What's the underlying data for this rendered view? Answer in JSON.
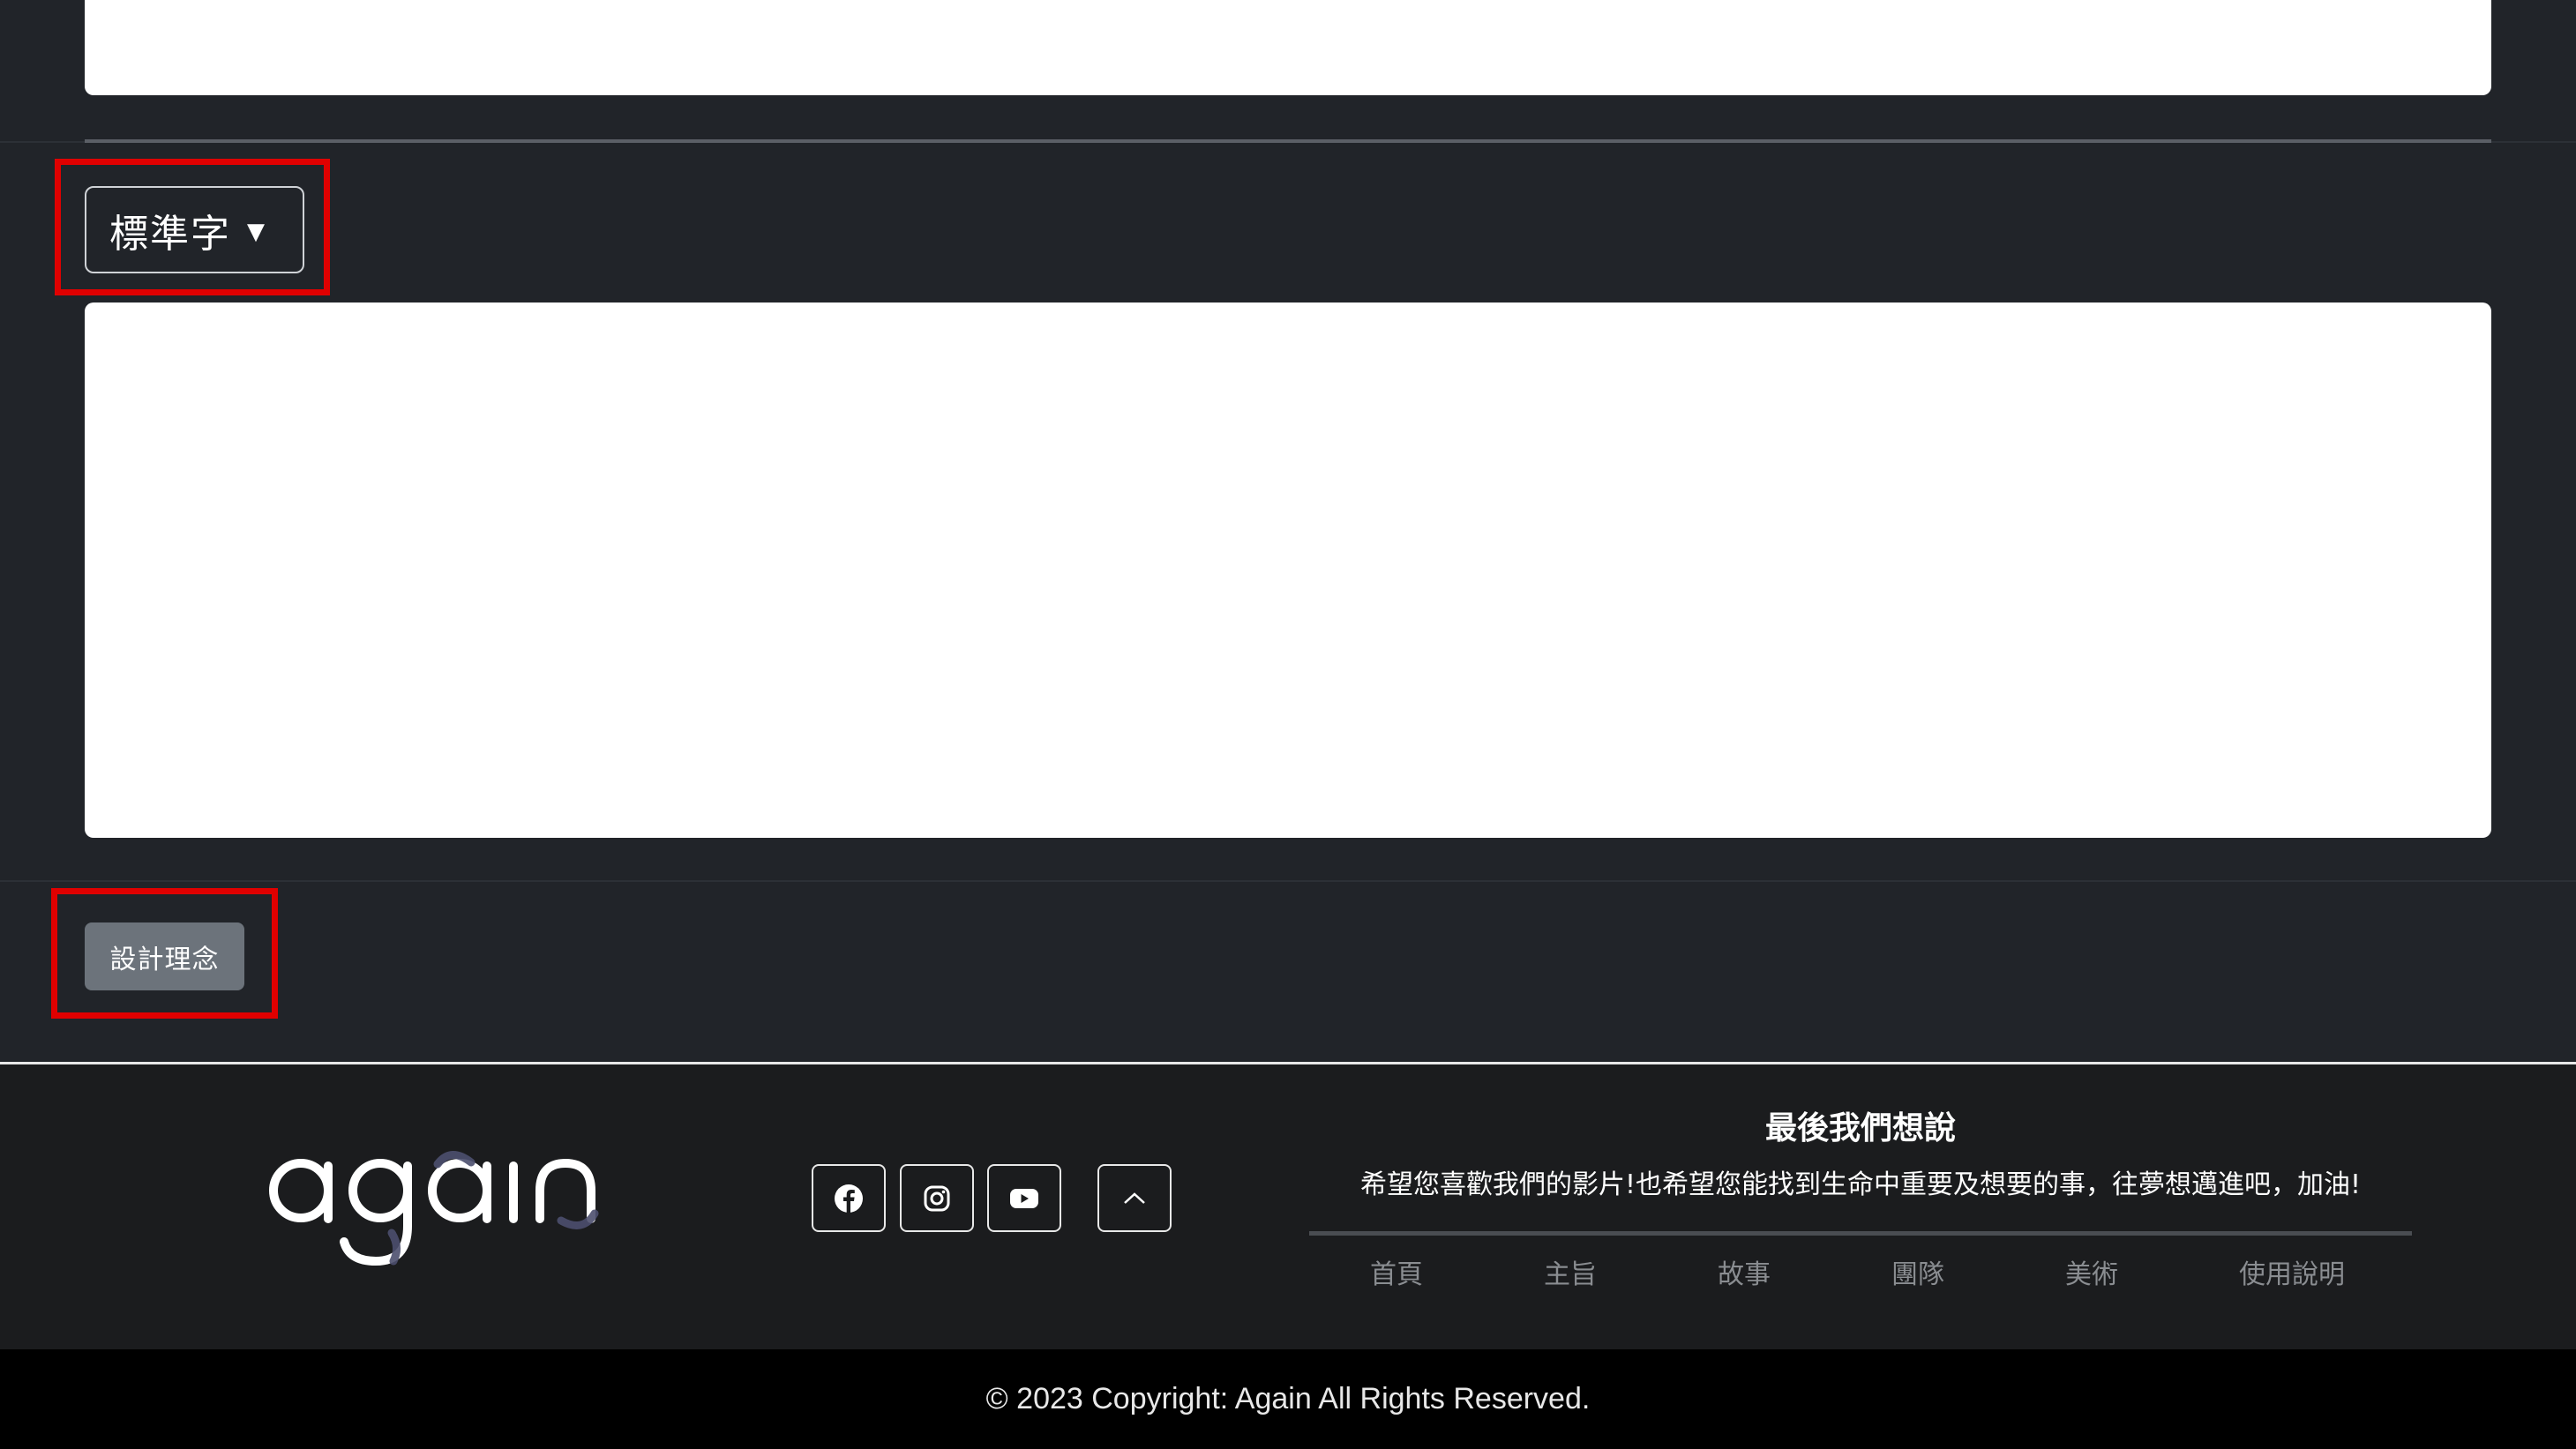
{
  "font_selector": {
    "selected": "標準字",
    "caret": "▼"
  },
  "design_button": {
    "label": "設計理念"
  },
  "footer": {
    "logo_text": "again",
    "social": [
      "facebook-icon",
      "instagram-icon",
      "youtube-icon"
    ],
    "back_to_top": "chevron-up-icon",
    "title": "最後我們想說",
    "message": "希望您喜歡我們的影片!也希望您能找到生命中重要及想要的事，往夢想邁進吧，加油!",
    "nav": [
      {
        "label": "首頁"
      },
      {
        "label": "主旨"
      },
      {
        "label": "故事"
      },
      {
        "label": "團隊"
      },
      {
        "label": "美術"
      },
      {
        "label": "使用說明"
      }
    ]
  },
  "copyright": "© 2023 Copyright: Again All Rights Reserved."
}
